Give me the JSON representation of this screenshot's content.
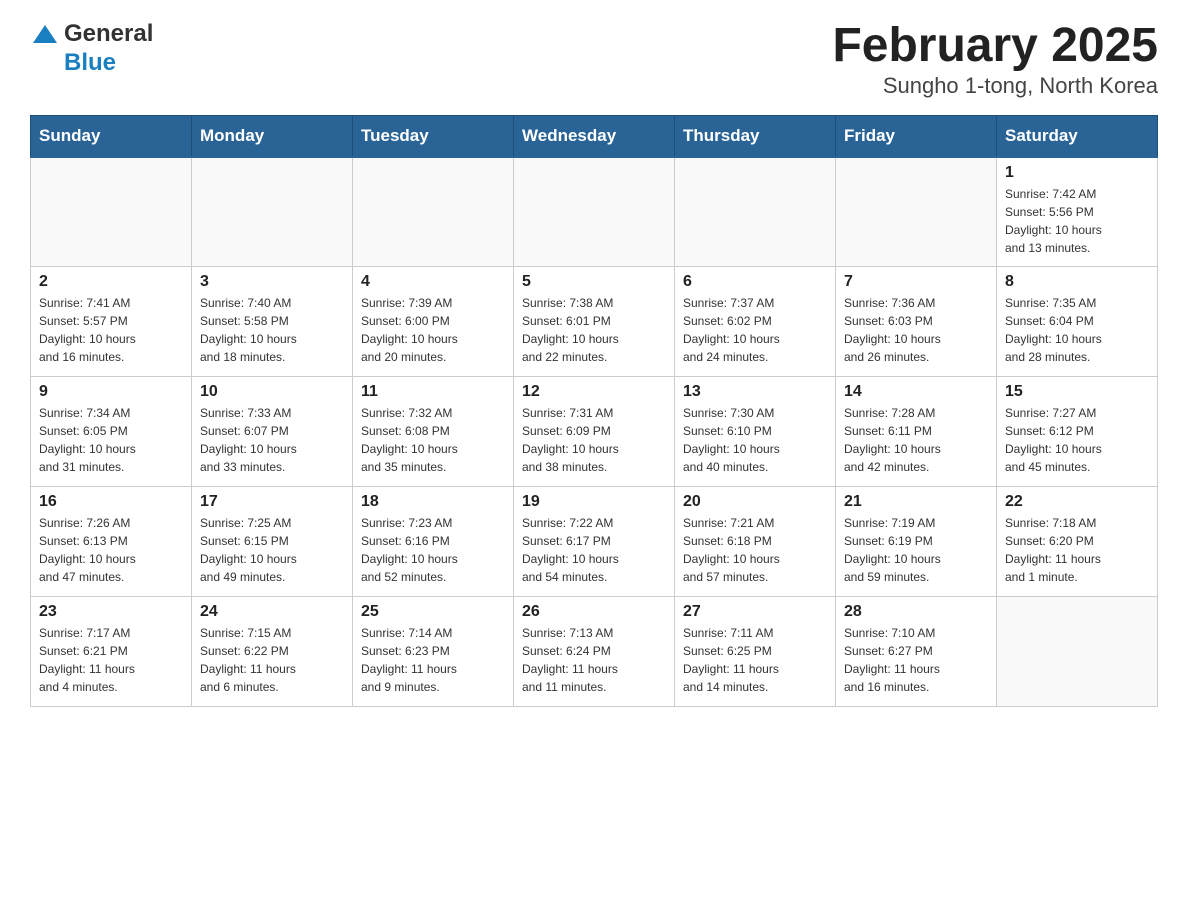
{
  "header": {
    "title": "February 2025",
    "subtitle": "Sungho 1-tong, North Korea",
    "logo_general": "General",
    "logo_blue": "Blue"
  },
  "days_of_week": [
    "Sunday",
    "Monday",
    "Tuesday",
    "Wednesday",
    "Thursday",
    "Friday",
    "Saturday"
  ],
  "weeks": [
    [
      {
        "day": "",
        "info": ""
      },
      {
        "day": "",
        "info": ""
      },
      {
        "day": "",
        "info": ""
      },
      {
        "day": "",
        "info": ""
      },
      {
        "day": "",
        "info": ""
      },
      {
        "day": "",
        "info": ""
      },
      {
        "day": "1",
        "info": "Sunrise: 7:42 AM\nSunset: 5:56 PM\nDaylight: 10 hours\nand 13 minutes."
      }
    ],
    [
      {
        "day": "2",
        "info": "Sunrise: 7:41 AM\nSunset: 5:57 PM\nDaylight: 10 hours\nand 16 minutes."
      },
      {
        "day": "3",
        "info": "Sunrise: 7:40 AM\nSunset: 5:58 PM\nDaylight: 10 hours\nand 18 minutes."
      },
      {
        "day": "4",
        "info": "Sunrise: 7:39 AM\nSunset: 6:00 PM\nDaylight: 10 hours\nand 20 minutes."
      },
      {
        "day": "5",
        "info": "Sunrise: 7:38 AM\nSunset: 6:01 PM\nDaylight: 10 hours\nand 22 minutes."
      },
      {
        "day": "6",
        "info": "Sunrise: 7:37 AM\nSunset: 6:02 PM\nDaylight: 10 hours\nand 24 minutes."
      },
      {
        "day": "7",
        "info": "Sunrise: 7:36 AM\nSunset: 6:03 PM\nDaylight: 10 hours\nand 26 minutes."
      },
      {
        "day": "8",
        "info": "Sunrise: 7:35 AM\nSunset: 6:04 PM\nDaylight: 10 hours\nand 28 minutes."
      }
    ],
    [
      {
        "day": "9",
        "info": "Sunrise: 7:34 AM\nSunset: 6:05 PM\nDaylight: 10 hours\nand 31 minutes."
      },
      {
        "day": "10",
        "info": "Sunrise: 7:33 AM\nSunset: 6:07 PM\nDaylight: 10 hours\nand 33 minutes."
      },
      {
        "day": "11",
        "info": "Sunrise: 7:32 AM\nSunset: 6:08 PM\nDaylight: 10 hours\nand 35 minutes."
      },
      {
        "day": "12",
        "info": "Sunrise: 7:31 AM\nSunset: 6:09 PM\nDaylight: 10 hours\nand 38 minutes."
      },
      {
        "day": "13",
        "info": "Sunrise: 7:30 AM\nSunset: 6:10 PM\nDaylight: 10 hours\nand 40 minutes."
      },
      {
        "day": "14",
        "info": "Sunrise: 7:28 AM\nSunset: 6:11 PM\nDaylight: 10 hours\nand 42 minutes."
      },
      {
        "day": "15",
        "info": "Sunrise: 7:27 AM\nSunset: 6:12 PM\nDaylight: 10 hours\nand 45 minutes."
      }
    ],
    [
      {
        "day": "16",
        "info": "Sunrise: 7:26 AM\nSunset: 6:13 PM\nDaylight: 10 hours\nand 47 minutes."
      },
      {
        "day": "17",
        "info": "Sunrise: 7:25 AM\nSunset: 6:15 PM\nDaylight: 10 hours\nand 49 minutes."
      },
      {
        "day": "18",
        "info": "Sunrise: 7:23 AM\nSunset: 6:16 PM\nDaylight: 10 hours\nand 52 minutes."
      },
      {
        "day": "19",
        "info": "Sunrise: 7:22 AM\nSunset: 6:17 PM\nDaylight: 10 hours\nand 54 minutes."
      },
      {
        "day": "20",
        "info": "Sunrise: 7:21 AM\nSunset: 6:18 PM\nDaylight: 10 hours\nand 57 minutes."
      },
      {
        "day": "21",
        "info": "Sunrise: 7:19 AM\nSunset: 6:19 PM\nDaylight: 10 hours\nand 59 minutes."
      },
      {
        "day": "22",
        "info": "Sunrise: 7:18 AM\nSunset: 6:20 PM\nDaylight: 11 hours\nand 1 minute."
      }
    ],
    [
      {
        "day": "23",
        "info": "Sunrise: 7:17 AM\nSunset: 6:21 PM\nDaylight: 11 hours\nand 4 minutes."
      },
      {
        "day": "24",
        "info": "Sunrise: 7:15 AM\nSunset: 6:22 PM\nDaylight: 11 hours\nand 6 minutes."
      },
      {
        "day": "25",
        "info": "Sunrise: 7:14 AM\nSunset: 6:23 PM\nDaylight: 11 hours\nand 9 minutes."
      },
      {
        "day": "26",
        "info": "Sunrise: 7:13 AM\nSunset: 6:24 PM\nDaylight: 11 hours\nand 11 minutes."
      },
      {
        "day": "27",
        "info": "Sunrise: 7:11 AM\nSunset: 6:25 PM\nDaylight: 11 hours\nand 14 minutes."
      },
      {
        "day": "28",
        "info": "Sunrise: 7:10 AM\nSunset: 6:27 PM\nDaylight: 11 hours\nand 16 minutes."
      },
      {
        "day": "",
        "info": ""
      }
    ]
  ]
}
